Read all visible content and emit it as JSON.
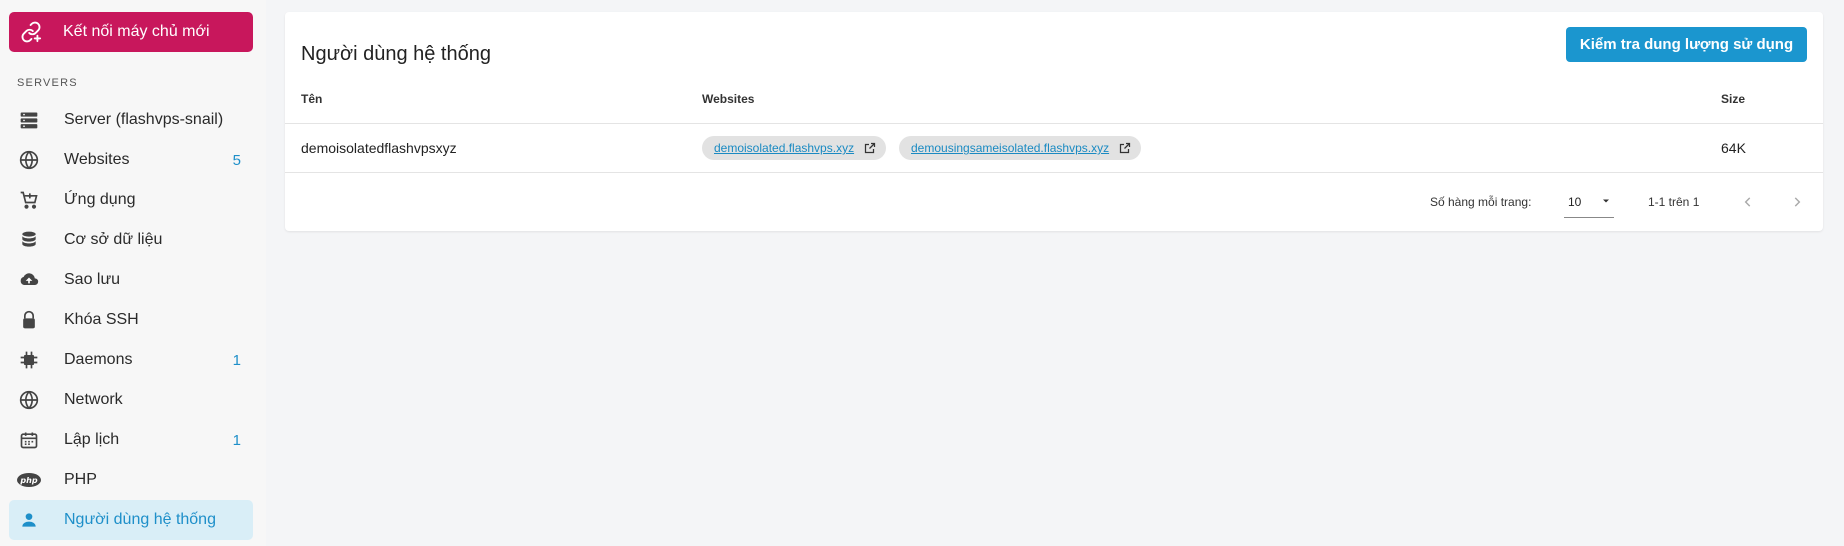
{
  "sidebar": {
    "connect_button": "Kết nối máy chủ mới",
    "section_label": "SERVERS",
    "items": [
      {
        "label": "Server (flashvps-snail)",
        "badge": "",
        "icon": "server-icon"
      },
      {
        "label": "Websites",
        "badge": "5",
        "icon": "globe-icon"
      },
      {
        "label": "Ứng dụng",
        "badge": "",
        "icon": "cart-icon"
      },
      {
        "label": "Cơ sở dữ liệu",
        "badge": "",
        "icon": "database-icon"
      },
      {
        "label": "Sao lưu",
        "badge": "",
        "icon": "cloud-upload-icon"
      },
      {
        "label": "Khóa SSH",
        "badge": "",
        "icon": "lock-icon"
      },
      {
        "label": "Daemons",
        "badge": "1",
        "icon": "chip-icon"
      },
      {
        "label": "Network",
        "badge": "",
        "icon": "globe-icon"
      },
      {
        "label": "Lập lịch",
        "badge": "1",
        "icon": "calendar-icon"
      },
      {
        "label": "PHP",
        "badge": "",
        "icon": "php-icon"
      },
      {
        "label": "Người dùng hệ thống",
        "badge": "",
        "icon": "person-icon",
        "active": true
      }
    ]
  },
  "main": {
    "title": "Người dùng hệ thống",
    "check_button": "Kiểm tra dung lượng sử dụng",
    "table": {
      "headers": [
        "Tên",
        "Websites",
        "Size"
      ],
      "rows": [
        {
          "name": "demoisolatedflashvpsxyz",
          "websites": [
            "demoisolated.flashvps.xyz",
            "demousingsameisolated.flashvps.xyz"
          ],
          "size": "64K"
        }
      ]
    },
    "pagination": {
      "rows_per_page_label": "Số hàng mỗi trang:",
      "rows_per_page": "10",
      "range": "1-1 trên 1"
    }
  },
  "colors": {
    "accent": "#1b96cf",
    "connect": "#c8175c",
    "active_bg": "#d9eef7"
  }
}
